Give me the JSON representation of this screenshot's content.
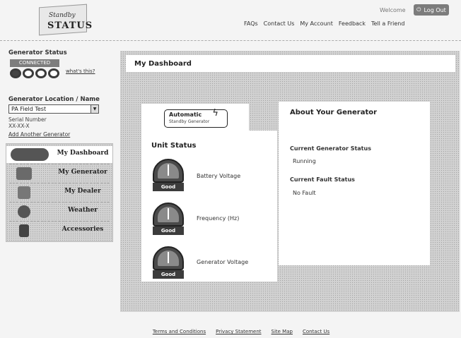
{
  "header": {
    "logo": {
      "line1": "Standby",
      "line2": "STATUS"
    },
    "welcome": "Welcome",
    "logout_label": "Log Out",
    "nav": [
      "FAQs",
      "Contact Us",
      "My Account",
      "Feedback",
      "Tell a Friend"
    ]
  },
  "sidebar": {
    "generator_status_label": "Generator Status",
    "connected_label": "CONNECTED",
    "whats_this": "what's this?",
    "generator_location_label": "Generator Location / Name",
    "selected_generator": "PA Field Test",
    "serial_number_label": "Serial Number",
    "serial_number_value": "XX-XX-X",
    "add_generator_link": "Add Another Generator",
    "nav": [
      {
        "label": "My Dashboard",
        "icon": "generator-icon",
        "active": true
      },
      {
        "label": "My Generator",
        "icon": "generator-unit-icon",
        "active": false
      },
      {
        "label": "My Dealer",
        "icon": "dealer-icon",
        "active": false
      },
      {
        "label": "Weather",
        "icon": "weather-icon",
        "active": false
      },
      {
        "label": "Accessories",
        "icon": "accessories-icon",
        "active": false
      }
    ]
  },
  "main": {
    "title": "My Dashboard",
    "auto_badge": {
      "line1": "Automatic",
      "line2": "Standby Generator"
    },
    "unit_status": {
      "title": "Unit Status",
      "gauges": [
        {
          "label": "Battery Voltage",
          "status": "Good"
        },
        {
          "label": "Frequency (Hz)",
          "status": "Good"
        },
        {
          "label": "Generator Voltage",
          "status": "Good"
        }
      ]
    },
    "about": {
      "title": "About Your Generator",
      "current_status_label": "Current Generator Status",
      "current_status_value": "Running",
      "fault_status_label": "Current Fault Status",
      "fault_status_value": "No Fault"
    }
  },
  "footer": {
    "links": [
      "Terms and Conditions",
      "Privacy Statement",
      "Site Map",
      "Contact Us"
    ]
  },
  "colors": {
    "background": "#f4f4f4",
    "dither_panel": "#d2d2d2",
    "badge_dark": "#3c3c3c",
    "button_gray": "#7c7c7c"
  }
}
